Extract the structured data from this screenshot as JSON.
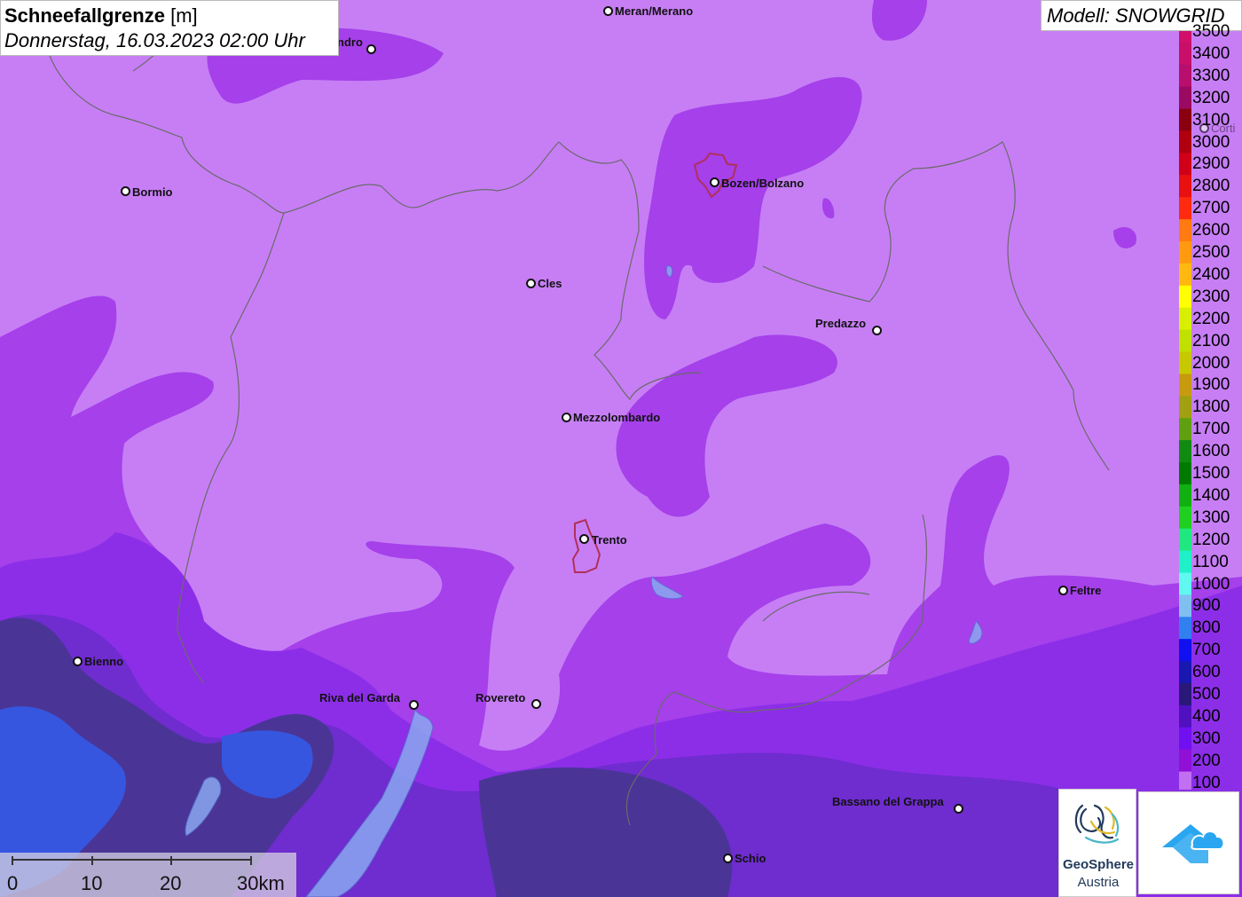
{
  "title": {
    "bold": "Schneefallgrenze",
    "unit": "[m]",
    "datetime": "Donnerstag, 16.03.2023 02:00 Uhr"
  },
  "model_label": "Modell: SNOWGRID",
  "legend": {
    "items": [
      {
        "label": "3500",
        "color": "#d0106a"
      },
      {
        "label": "3400",
        "color": "#c8106a"
      },
      {
        "label": "3300",
        "color": "#b80e6e"
      },
      {
        "label": "3200",
        "color": "#9a0a62"
      },
      {
        "label": "3100",
        "color": "#8a0010"
      },
      {
        "label": "3000",
        "color": "#b00010"
      },
      {
        "label": "2900",
        "color": "#d00018"
      },
      {
        "label": "2800",
        "color": "#e81010"
      },
      {
        "label": "2700",
        "color": "#ff2a10"
      },
      {
        "label": "2600",
        "color": "#ff7a10"
      },
      {
        "label": "2500",
        "color": "#ff9a10"
      },
      {
        "label": "2400",
        "color": "#ffb810"
      },
      {
        "label": "2300",
        "color": "#ffff00"
      },
      {
        "label": "2200",
        "color": "#d8f000"
      },
      {
        "label": "2100",
        "color": "#c0e000"
      },
      {
        "label": "2000",
        "color": "#c8c800"
      },
      {
        "label": "1900",
        "color": "#c89a10"
      },
      {
        "label": "1800",
        "color": "#a0a010"
      },
      {
        "label": "1700",
        "color": "#60a010"
      },
      {
        "label": "1600",
        "color": "#108a10"
      },
      {
        "label": "1500",
        "color": "#007a00"
      },
      {
        "label": "1400",
        "color": "#10b010"
      },
      {
        "label": "1300",
        "color": "#20d020"
      },
      {
        "label": "1200",
        "color": "#20e880"
      },
      {
        "label": "1100",
        "color": "#20f0c8"
      },
      {
        "label": "1000",
        "color": "#60f8f0"
      },
      {
        "label": "900",
        "color": "#80c0f0"
      },
      {
        "label": "800",
        "color": "#3080f0"
      },
      {
        "label": "700",
        "color": "#1010f0"
      },
      {
        "label": "600",
        "color": "#1818b0"
      },
      {
        "label": "500",
        "color": "#281878"
      },
      {
        "label": "400",
        "color": "#5010c0"
      },
      {
        "label": "300",
        "color": "#7010f0"
      },
      {
        "label": "200",
        "color": "#9010d8"
      },
      {
        "label": "100",
        "color": "#c070f0"
      }
    ]
  },
  "cities": [
    {
      "name": "Meran/Merano"
    },
    {
      "name": "ndro"
    },
    {
      "name": "Bormio"
    },
    {
      "name": "Bozen/Bolzano"
    },
    {
      "name": "Cles"
    },
    {
      "name": "Predazzo"
    },
    {
      "name": "Mezzolombardo"
    },
    {
      "name": "Trento"
    },
    {
      "name": "Feltre"
    },
    {
      "name": "Bienno"
    },
    {
      "name": "Riva del Garda"
    },
    {
      "name": "Rovereto"
    },
    {
      "name": "Bassano del Grappa"
    },
    {
      "name": "Schio"
    },
    {
      "name": "Corti"
    }
  ],
  "scale": {
    "labels": [
      "0",
      "10",
      "20",
      "30km"
    ]
  },
  "logo": {
    "line1": "GeoSphere",
    "line2": "Austria"
  },
  "colors": {
    "background": "#c77ef5",
    "zone_200": "#9a2fe6",
    "zone_300": "#8a25ea",
    "zone_400": "#6a2ac8",
    "zone_500": "#4a2a90",
    "zone_700": "#3050e0"
  }
}
